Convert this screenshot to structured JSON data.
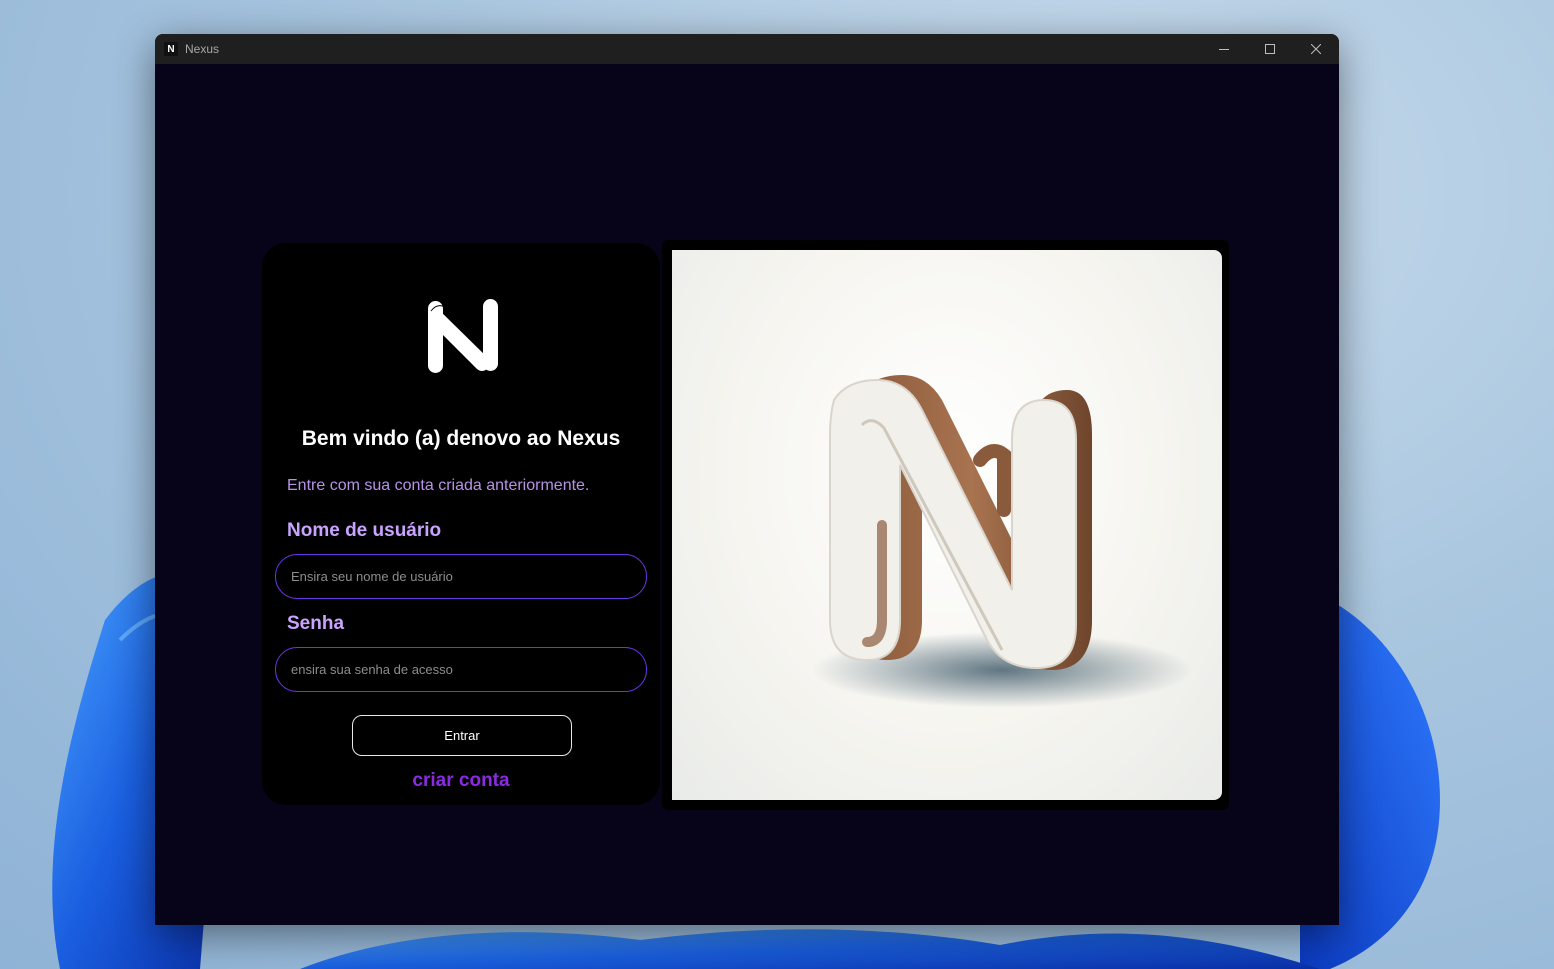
{
  "window": {
    "title": "Nexus",
    "app_icon_letter": "N",
    "controls": [
      "minimize",
      "maximize",
      "close"
    ]
  },
  "login": {
    "welcome_title": "Bem vindo (a) denovo ao Nexus",
    "subtitle": "Entre com sua conta criada anteriormente.",
    "username_label": "Nome de usuário",
    "username_placeholder": "Ensira seu nome de usuário",
    "password_label": "Senha",
    "password_placeholder": "ensira sua senha de acesso",
    "submit_label": "Entrar",
    "create_account_label": "criar conta"
  },
  "colors": {
    "window_bg": "#07041a",
    "card_bg": "#000000",
    "accent_purple": "#8a2be2",
    "label_purple": "#c9a3ff",
    "input_border": "#6d35e8"
  },
  "icons": {
    "logo": "nexus-logo-icon",
    "hero": "nexus-3d-logo-image"
  }
}
